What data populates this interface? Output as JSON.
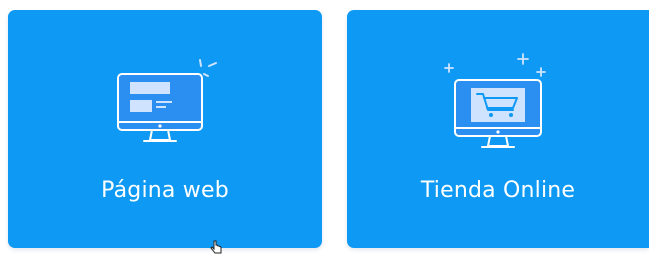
{
  "cards": [
    {
      "label": "Página web",
      "icon": "website-monitor-icon"
    },
    {
      "label": "Tienda Online",
      "icon": "shopping-cart-monitor-icon"
    }
  ],
  "colors": {
    "card_background": "#0e9af4",
    "icon_stroke": "#ffffff",
    "icon_fill_light": "#cfe3ff",
    "screen_fill": "#2a8ff0"
  }
}
